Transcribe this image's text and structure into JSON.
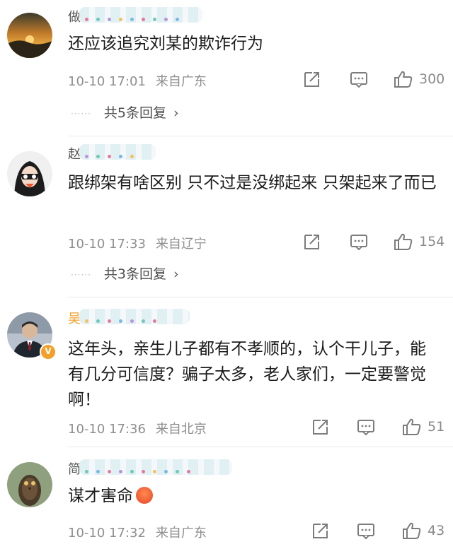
{
  "comments": [
    {
      "username": "做",
      "text": "还应该追究刘某的欺诈行为",
      "time": "10-10 17:01",
      "location": "来自广东",
      "likes": "300",
      "replies": "共5条回复",
      "avatar_icon": "sunset-avatar"
    },
    {
      "username": "赵",
      "text": "跟绑架有啥区别 只不过是没绑起来 只架起来了而已",
      "time": "10-10 17:33",
      "location": "来自辽宁",
      "likes": "154",
      "replies": "共3条回复",
      "avatar_icon": "masked-face-avatar"
    },
    {
      "username": "吴",
      "text": "这年头，亲生儿子都有不孝顺的，认个干儿子，能有几分可信度？骗子太多，老人家们，一定要警觉啊！",
      "time": "10-10 17:36",
      "location": "来自北京",
      "likes": "51",
      "avatar_icon": "man-in-suit-avatar",
      "verified_badge": "V"
    },
    {
      "username": "简",
      "text": "谋才害命",
      "time": "10-10 17:32",
      "location": "来自广东",
      "likes": "43",
      "avatar_icon": "owl-avatar"
    }
  ],
  "replies_chevron": "›",
  "colors": {
    "accent": "#f2a02a",
    "meta": "#8e8e8e",
    "icon": "#7c7c7c"
  }
}
